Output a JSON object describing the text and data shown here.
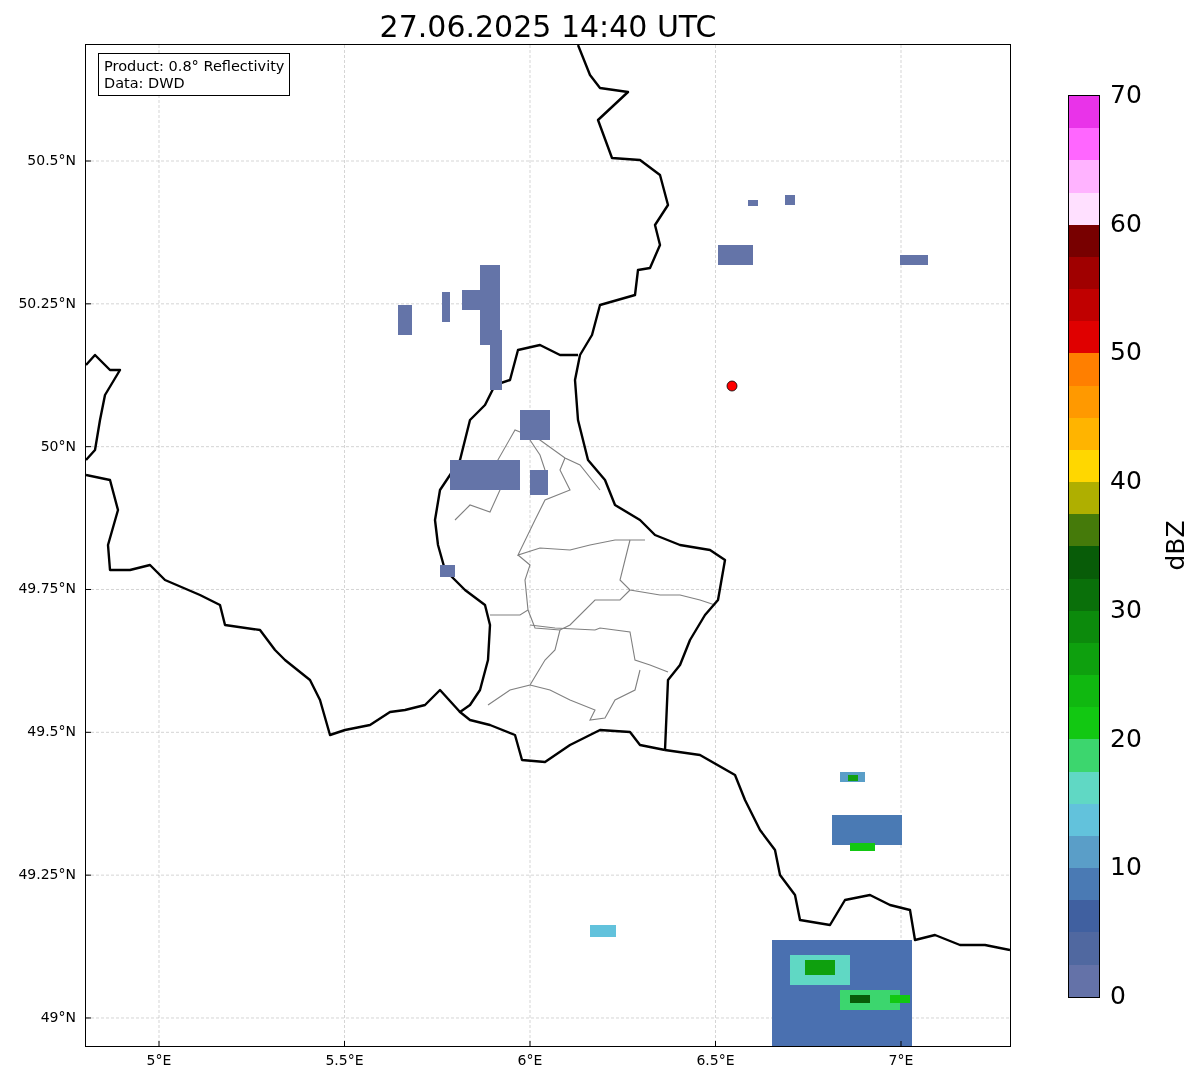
{
  "title": "27.06.2025 14:40 UTC",
  "info_box": {
    "lines": [
      "Product: 0.8° Reflectivity",
      "Data: DWD"
    ]
  },
  "x_ticks": [
    "5°E",
    "5.5°E",
    "6°E",
    "6.5°E",
    "7°E"
  ],
  "y_ticks": [
    "50.5°N",
    "50.25°N",
    "50°N",
    "49.75°N",
    "49.5°N",
    "49.25°N",
    "49°N"
  ],
  "colorbar": {
    "label": "dBZ",
    "ticks": [
      "70",
      "60",
      "50",
      "40",
      "30",
      "20",
      "10",
      "0"
    ],
    "bands": [
      {
        "color": "#e933e9"
      },
      {
        "color": "#ff66ff"
      },
      {
        "color": "#ffb3ff"
      },
      {
        "color": "#ffe0ff"
      },
      {
        "color": "#780000"
      },
      {
        "color": "#a00000"
      },
      {
        "color": "#c00000"
      },
      {
        "color": "#e00000"
      },
      {
        "color": "#ff7f00"
      },
      {
        "color": "#ff9900"
      },
      {
        "color": "#ffb400"
      },
      {
        "color": "#ffd700"
      },
      {
        "color": "#afaf00"
      },
      {
        "color": "#457a0a"
      },
      {
        "color": "#085c08"
      },
      {
        "color": "#0a700a"
      },
      {
        "color": "#0c8a0c"
      },
      {
        "color": "#0ea00e"
      },
      {
        "color": "#10b810"
      },
      {
        "color": "#12c812"
      },
      {
        "color": "#3cd66e"
      },
      {
        "color": "#60d8c4"
      },
      {
        "color": "#62c2dc"
      },
      {
        "color": "#5a9ec8"
      },
      {
        "color": "#4a7ab4"
      },
      {
        "color": "#4060a0"
      },
      {
        "color": "#5068a0"
      },
      {
        "color": "#6472a8"
      }
    ]
  }
}
